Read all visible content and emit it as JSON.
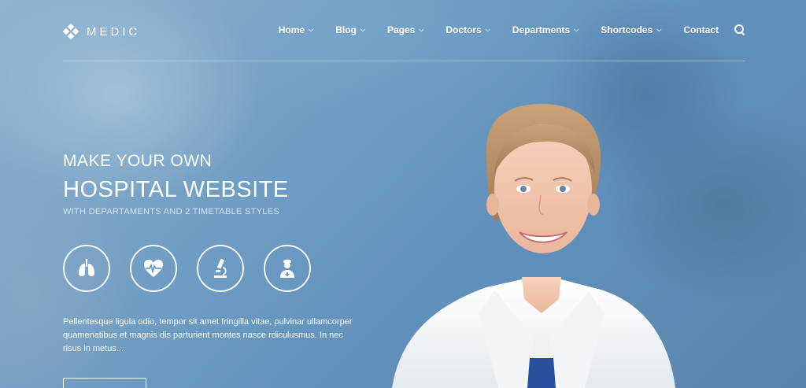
{
  "brand": {
    "name": "MEDIC"
  },
  "nav": {
    "items": [
      {
        "label": "Home",
        "has_dropdown": true
      },
      {
        "label": "Blog",
        "has_dropdown": true
      },
      {
        "label": "Pages",
        "has_dropdown": true
      },
      {
        "label": "Doctors",
        "has_dropdown": true
      },
      {
        "label": "Departments",
        "has_dropdown": true
      },
      {
        "label": "Shortcodes",
        "has_dropdown": true
      },
      {
        "label": "Contact",
        "has_dropdown": false
      }
    ],
    "search_icon": "search-icon"
  },
  "hero": {
    "line1": "MAKE YOUR OWN",
    "line2": "HOSPITAL WEBSITE",
    "subtitle": "WITH DEPARTAMENTS AND 2 TIMETABLE STYLES",
    "icons": [
      "lungs-icon",
      "heart-pulse-icon",
      "microscope-icon",
      "doctor-icon"
    ],
    "description": "Pellentesque ligula odio, tempor sit amet fringilla vitae, pulvinar ullamcorper quamenatibus et magnis dis parturient montes nasce rdiculusmus. In nec risus in metus...."
  },
  "colors": {
    "background": "#6d9bc2",
    "text": "#ffffff"
  }
}
